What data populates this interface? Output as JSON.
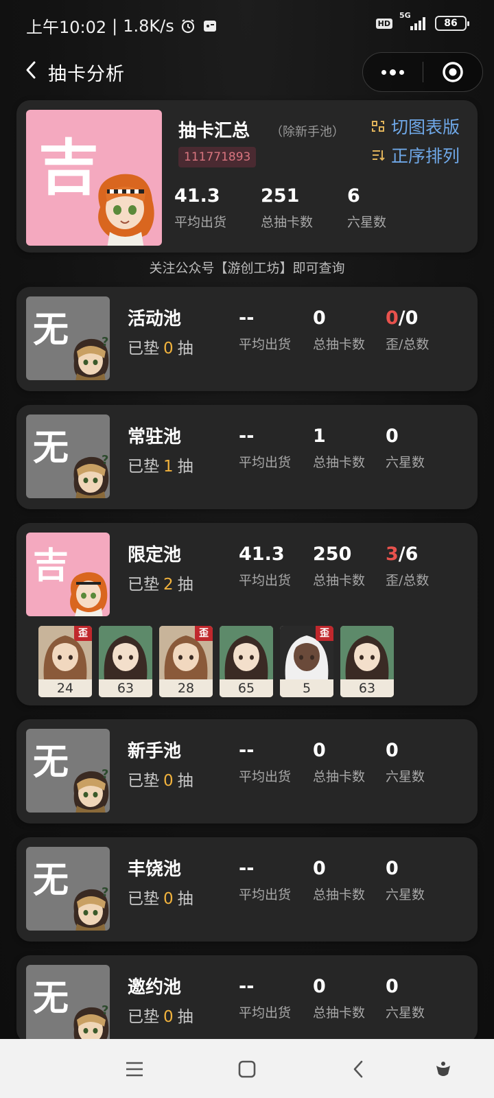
{
  "status_bar": {
    "time": "上午10:02",
    "separator": "|",
    "speed": "1.8K/s",
    "hd": "HD",
    "network": "5G",
    "battery": "86"
  },
  "nav": {
    "title": "抽卡分析"
  },
  "summary": {
    "avatar_glyph": "吉",
    "title": "抽卡汇总",
    "subtitle": "（除新手池）",
    "uid": "111771893",
    "switch_label": "切图表版",
    "sort_label": "正序排列",
    "stats": [
      {
        "value": "41.3",
        "label": "平均出货"
      },
      {
        "value": "251",
        "label": "总抽卡数"
      },
      {
        "value": "6",
        "label": "六星数"
      }
    ]
  },
  "notice": "关注公众号【游创工坊】即可查询",
  "pools": [
    {
      "name": "活动池",
      "glyph": "无",
      "pity_prefix": "已垫",
      "pity": "0",
      "pity_suffix": "抽",
      "avg": "--",
      "avg_label": "平均出货",
      "total": "0",
      "total_label": "总抽卡数",
      "third_red": "0",
      "third_rest": "/0",
      "third_label": "歪/总数"
    },
    {
      "name": "常驻池",
      "glyph": "无",
      "pity_prefix": "已垫",
      "pity": "1",
      "pity_suffix": "抽",
      "avg": "--",
      "avg_label": "平均出货",
      "total": "1",
      "total_label": "总抽卡数",
      "third_red": "",
      "third_rest": "0",
      "third_label": "六星数"
    },
    {
      "name": "限定池",
      "glyph": "吉",
      "pity_prefix": "已垫",
      "pity": "2",
      "pity_suffix": "抽",
      "avg": "41.3",
      "avg_label": "平均出货",
      "total": "250",
      "total_label": "总抽卡数",
      "third_red": "3",
      "third_rest": "/6",
      "third_label": "歪/总数",
      "characters": [
        {
          "count": "24",
          "tag": "歪"
        },
        {
          "count": "63",
          "tag": ""
        },
        {
          "count": "28",
          "tag": "歪"
        },
        {
          "count": "65",
          "tag": ""
        },
        {
          "count": "5",
          "tag": "歪"
        },
        {
          "count": "63",
          "tag": ""
        }
      ]
    },
    {
      "name": "新手池",
      "glyph": "无",
      "pity_prefix": "已垫",
      "pity": "0",
      "pity_suffix": "抽",
      "avg": "--",
      "avg_label": "平均出货",
      "total": "0",
      "total_label": "总抽卡数",
      "third_red": "",
      "third_rest": "0",
      "third_label": "六星数"
    },
    {
      "name": "丰饶池",
      "glyph": "无",
      "pity_prefix": "已垫",
      "pity": "0",
      "pity_suffix": "抽",
      "avg": "--",
      "avg_label": "平均出货",
      "total": "0",
      "total_label": "总抽卡数",
      "third_red": "",
      "third_rest": "0",
      "third_label": "六星数"
    },
    {
      "name": "邀约池",
      "glyph": "无",
      "pity_prefix": "已垫",
      "pity": "0",
      "pity_suffix": "抽",
      "avg": "--",
      "avg_label": "平均出货",
      "total": "0",
      "total_label": "总抽卡数",
      "third_red": "",
      "third_rest": "0",
      "third_label": "六星数"
    }
  ],
  "colors": {
    "accent_blue": "#6fa8e8",
    "gold": "#f2b33d",
    "red": "#e8524d",
    "pink": "#f4a9bf",
    "gray_avatar": "#7a7a7a"
  }
}
